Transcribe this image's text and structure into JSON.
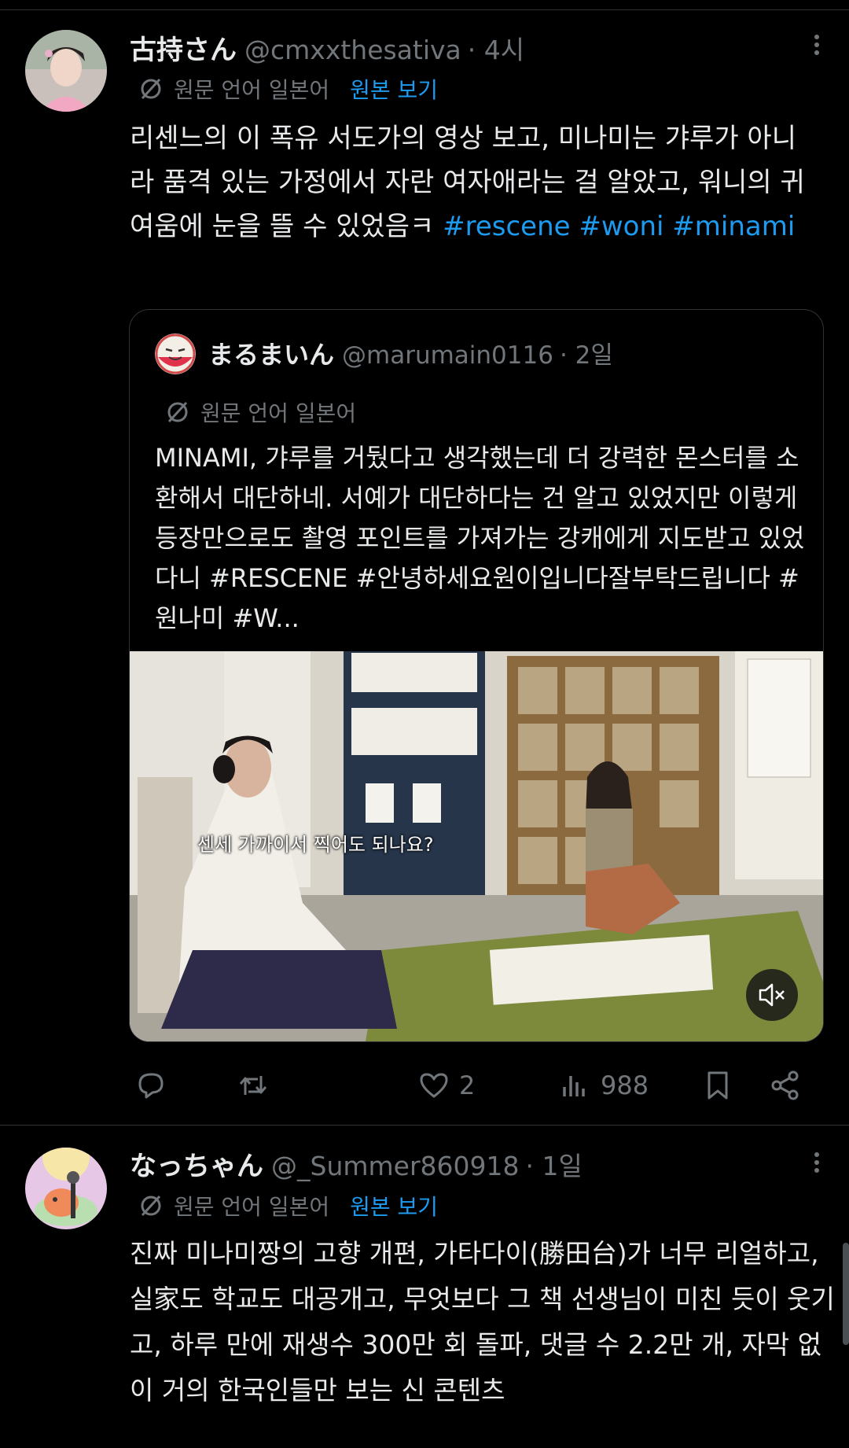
{
  "tweet1": {
    "display_name": "古持さん",
    "handle": "@cmxxthesativa",
    "time": "· 4시",
    "translation_label": "원문 언어 일본어",
    "translation_link": "원본 보기",
    "text_plain": "리센느의 이 폭유 서도가의 영상 보고, 미나미는 갸루가 아니라 품격 있는 가정에서 자란 여자애라는 걸 알았고, 워니의 귀여움에 눈을 뜰 수 있었음ㅋ",
    "hashtags": [
      "#rescene",
      "#woni",
      "#minami"
    ],
    "quote": {
      "display_name": "まるまいん",
      "handle": "@marumain0116",
      "time": "· 2일",
      "translation_label": "원문 언어 일본어",
      "text": "MINAMI, 갸루를 거뒀다고 생각했는데 더 강력한 몬스터를 소환해서 대단하네. 서예가 대단하다는 건 알고 있었지만 이렇게 등장만으로도 촬영 포인트를 가져가는 강캐에게 지도받고 있었다니 #RESCENE #안녕하세요원이입니다잘부탁드립니다 #원나미 #W...",
      "video_caption": "센세 가까이서 찍어도 되나요?"
    },
    "actions": {
      "likes": "2",
      "views": "988"
    }
  },
  "tweet2": {
    "display_name": "なっちゃん",
    "handle": "@_Summer860918",
    "time": "· 1일",
    "translation_label": "원문 언어 일본어",
    "translation_link": "원본 보기",
    "text": "진짜 미나미짱의 고향 개편, 가타다이(勝田台)가 너무 리얼하고, 실家도 학교도 대공개고, 무엇보다 그 책 선생님이 미친 듯이 웃기고, 하루 만에 재생수 300만 회 돌파, 댓글 수 2.2만 개, 자막 없이 거의 한국인들만 보는 신 콘텐츠"
  },
  "colors": {
    "background": "#000000",
    "text": "#e7e9ea",
    "muted": "#71767b",
    "link": "#1d9bf0",
    "border": "#2f3336"
  }
}
